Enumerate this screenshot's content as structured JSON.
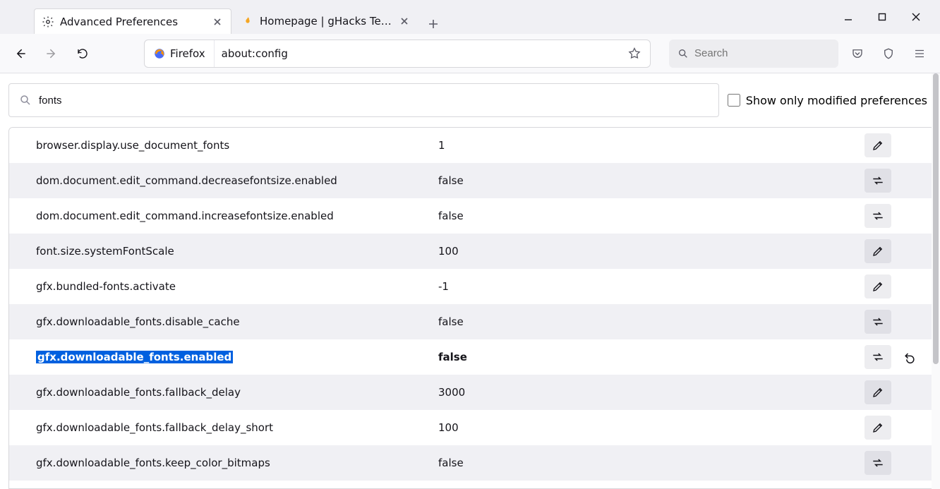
{
  "tabs": [
    {
      "title": "Advanced Preferences",
      "favicon": "gear-icon",
      "active": true
    },
    {
      "title": "Homepage | gHacks Technolog…",
      "favicon": "flame-icon",
      "active": false
    }
  ],
  "toolbar": {
    "identity_label": "Firefox",
    "url": "about:config",
    "search_placeholder": "Search"
  },
  "config": {
    "filter_value": "fonts",
    "modified_only_label": "Show only modified preferences",
    "modified_only_checked": false,
    "prefs": [
      {
        "name": "browser.display.use_document_fonts",
        "value": "1",
        "action": "edit",
        "modified": false,
        "selected": false,
        "reset": false
      },
      {
        "name": "dom.document.edit_command.decreasefontsize.enabled",
        "value": "false",
        "action": "toggle",
        "modified": false,
        "selected": false,
        "reset": false
      },
      {
        "name": "dom.document.edit_command.increasefontsize.enabled",
        "value": "false",
        "action": "toggle",
        "modified": false,
        "selected": false,
        "reset": false
      },
      {
        "name": "font.size.systemFontScale",
        "value": "100",
        "action": "edit",
        "modified": false,
        "selected": false,
        "reset": false
      },
      {
        "name": "gfx.bundled-fonts.activate",
        "value": "-1",
        "action": "edit",
        "modified": false,
        "selected": false,
        "reset": false
      },
      {
        "name": "gfx.downloadable_fonts.disable_cache",
        "value": "false",
        "action": "toggle",
        "modified": false,
        "selected": false,
        "reset": false
      },
      {
        "name": "gfx.downloadable_fonts.enabled",
        "value": "false",
        "action": "toggle",
        "modified": true,
        "selected": true,
        "reset": true
      },
      {
        "name": "gfx.downloadable_fonts.fallback_delay",
        "value": "3000",
        "action": "edit",
        "modified": false,
        "selected": false,
        "reset": false
      },
      {
        "name": "gfx.downloadable_fonts.fallback_delay_short",
        "value": "100",
        "action": "edit",
        "modified": false,
        "selected": false,
        "reset": false
      },
      {
        "name": "gfx.downloadable_fonts.keep_color_bitmaps",
        "value": "false",
        "action": "toggle",
        "modified": false,
        "selected": false,
        "reset": false
      }
    ]
  },
  "colors": {
    "accent": "#0060df"
  }
}
